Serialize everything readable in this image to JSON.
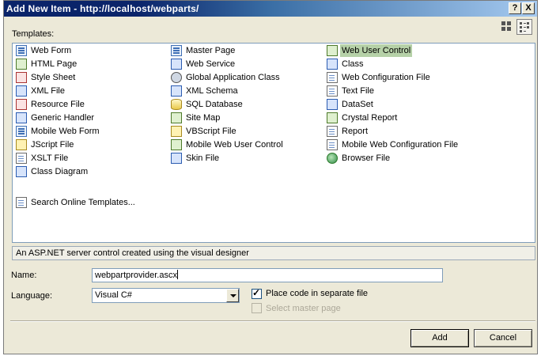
{
  "window": {
    "title": "Add New Item - http://localhost/webparts/",
    "help_label": "?",
    "close_label": "X"
  },
  "templates": {
    "label": "Templates:",
    "columns": [
      [
        {
          "label": "Web Form",
          "icon": "web-form-icon"
        },
        {
          "label": "HTML Page",
          "icon": "html-page-icon"
        },
        {
          "label": "Style Sheet",
          "icon": "style-sheet-icon"
        },
        {
          "label": "XML File",
          "icon": "xml-file-icon"
        },
        {
          "label": "Resource File",
          "icon": "resource-file-icon"
        },
        {
          "label": "Generic Handler",
          "icon": "generic-handler-icon"
        },
        {
          "label": "Mobile Web Form",
          "icon": "mobile-web-form-icon"
        },
        {
          "label": "JScript File",
          "icon": "jscript-file-icon"
        },
        {
          "label": "XSLT File",
          "icon": "xslt-file-icon"
        },
        {
          "label": "Class Diagram",
          "icon": "class-diagram-icon"
        }
      ],
      [
        {
          "label": "Master Page",
          "icon": "master-page-icon"
        },
        {
          "label": "Web Service",
          "icon": "web-service-icon"
        },
        {
          "label": "Global Application Class",
          "icon": "global-application-class-icon"
        },
        {
          "label": "XML Schema",
          "icon": "xml-schema-icon"
        },
        {
          "label": "SQL Database",
          "icon": "sql-database-icon"
        },
        {
          "label": "Site Map",
          "icon": "site-map-icon"
        },
        {
          "label": "VBScript File",
          "icon": "vbscript-file-icon"
        },
        {
          "label": "Mobile Web User Control",
          "icon": "mobile-web-user-control-icon"
        },
        {
          "label": "Skin File",
          "icon": "skin-file-icon"
        }
      ],
      [
        {
          "label": "Web User Control",
          "icon": "web-user-control-icon",
          "selected": true
        },
        {
          "label": "Class",
          "icon": "class-icon"
        },
        {
          "label": "Web Configuration File",
          "icon": "web-configuration-file-icon"
        },
        {
          "label": "Text File",
          "icon": "text-file-icon"
        },
        {
          "label": "DataSet",
          "icon": "dataset-icon"
        },
        {
          "label": "Crystal Report",
          "icon": "crystal-report-icon"
        },
        {
          "label": "Report",
          "icon": "report-icon"
        },
        {
          "label": "Mobile Web Configuration File",
          "icon": "mobile-web-configuration-file-icon"
        },
        {
          "label": "Browser File",
          "icon": "browser-file-icon"
        }
      ]
    ],
    "search_online": "Search Online Templates..."
  },
  "description": "An ASP.NET server control created using the visual designer",
  "form": {
    "name_label": "Name:",
    "name_value": "webpartprovider.ascx",
    "language_label": "Language:",
    "language_value": "Visual C#",
    "place_code_label": "Place code in separate file",
    "place_code_checked": true,
    "select_master_label": "Select master page",
    "select_master_checked": false
  },
  "buttons": {
    "add": "Add",
    "cancel": "Cancel"
  },
  "colors": {
    "titlebar_start": "#0a246a",
    "titlebar_end": "#a6caf0",
    "selection": "#b6d1a8",
    "dialog_bg": "#ECE9D8"
  }
}
